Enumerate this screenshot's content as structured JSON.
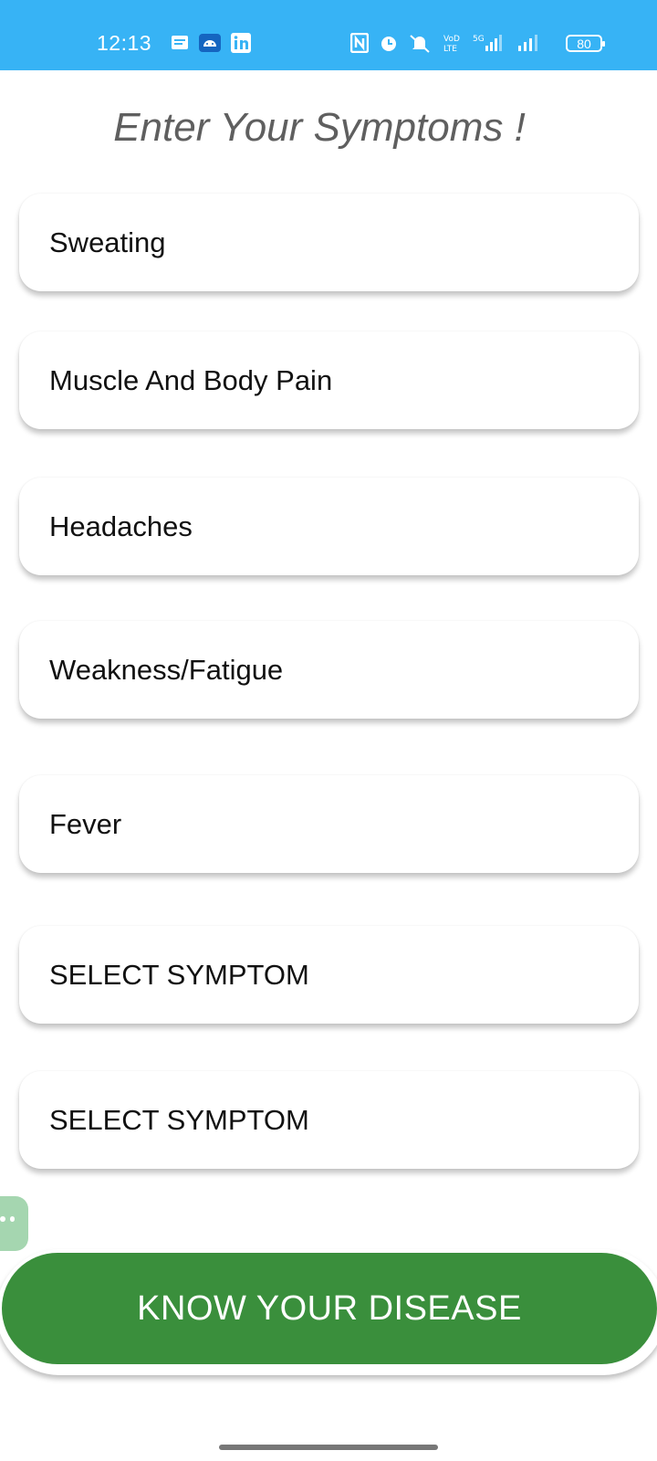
{
  "status_bar": {
    "time": "12:13",
    "battery": "80",
    "network": "5G",
    "icons_left": [
      "message-icon",
      "android-icon",
      "linkedin-icon"
    ],
    "icons_right": [
      "nfc-icon",
      "alarm-icon",
      "mute-icon",
      "volte-icon",
      "signal-icon",
      "signal-icon",
      "battery-icon"
    ]
  },
  "header": {
    "title": "Enter Your Symptoms !"
  },
  "symptoms": [
    {
      "label": "Sweating"
    },
    {
      "label": "Muscle And Body Pain"
    },
    {
      "label": "Headaches"
    },
    {
      "label": "Weakness/Fatigue"
    },
    {
      "label": "Fever"
    },
    {
      "label": "SELECT SYMPTOM"
    },
    {
      "label": "SELECT SYMPTOM"
    }
  ],
  "action": {
    "label": "KNOW YOUR DISEASE"
  },
  "colors": {
    "status_bar": "#37b3f5",
    "button": "#3a8f3c",
    "fab": "#a5d6b0"
  }
}
